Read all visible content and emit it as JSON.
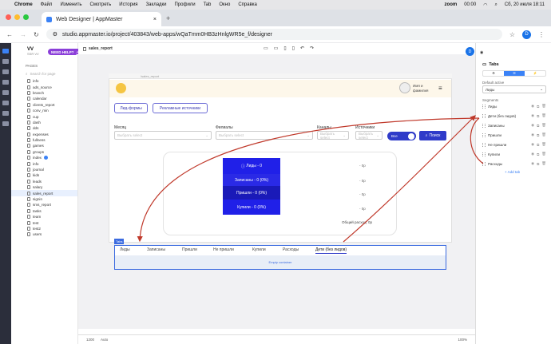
{
  "mac": {
    "app": "Chrome",
    "menu": [
      "Файл",
      "Изменить",
      "Смотреть",
      "История",
      "Закладки",
      "Профили",
      "Tab",
      "Окно",
      "Справка"
    ],
    "status": [
      "zoom",
      "00:00",
      "Сб, 20 июля  18:11"
    ]
  },
  "browser": {
    "tab_title": "Web Designer | AppMaster",
    "url": "studio.appmaster.io/project/403843/web-apps/wQaTmm0HB3zHnlgWR5e_f/designer",
    "profile": "D"
  },
  "project": {
    "name": "VV",
    "sub": "SSR VV",
    "need_help": "NEED HELP?",
    "community": "Ask community!"
  },
  "pages": {
    "header": "PAGES",
    "search": "Search for page",
    "items": [
      "info",
      "ads_source",
      "branch",
      "calendar",
      "clients_report",
      "conv_min",
      "cup",
      "dash",
      "dds",
      "expenses",
      "fullness",
      "games",
      "groups",
      "index",
      "info",
      "journal",
      "kids",
      "leads",
      "salary",
      "sales_report",
      "signin",
      "sms_report",
      "tasks",
      "team",
      "test",
      "test2",
      "users"
    ],
    "selected": "sales_report"
  },
  "toolbar": {
    "tab": "sales_report"
  },
  "preview": {
    "url": "/sales_report",
    "user": "Имя и\nфамилия",
    "btn1": "Лид-формы",
    "btn2": "Рекламные источники",
    "filters": [
      {
        "label": "Месяц",
        "ph": "Выбрать select"
      },
      {
        "label": "Филиалы",
        "ph": "Выбрать select"
      },
      {
        "label": "Каналы",
        "ph": "Выбрать select"
      },
      {
        "label": "Источники",
        "ph": "Выбрать select"
      }
    ],
    "toggle": "Все",
    "search": "Поиск",
    "stats": [
      {
        "t": "Лиды -   0",
        "r": "- 0р"
      },
      {
        "t": "Записаны -   0 (0%)",
        "r": "- 0р"
      },
      {
        "t": "Пришли -   0 (0%)",
        "r": "- 0р"
      },
      {
        "t": "Купили -   0 (0%)",
        "r": "- 0р"
      }
    ],
    "total": "Общий расход: 0р"
  },
  "tabs_component": {
    "badge": "Tabs",
    "items": [
      "Лиды",
      "Записаны",
      "Пришли",
      "Не пришли",
      "Купили",
      "Расходы",
      "Дети (без лидов)"
    ],
    "active": "Дети (без лидов)",
    "empty": "Empty container"
  },
  "rpanel": {
    "title": "Tabs",
    "default_active_label": "Default active",
    "default_active_value": "Лиды",
    "segments_label": "Segments",
    "segments": [
      "Лиды",
      "Дети (без лидов)",
      "Записаны",
      "Пришли",
      "Не пришли",
      "Купили",
      "Расходы"
    ],
    "add": "+ Add tab"
  },
  "bottom": {
    "width": "1200",
    "zoom": "100%",
    "auto": "Auto"
  },
  "colors": {
    "accent": "#3b82f6",
    "stats_blue": "#2020e8",
    "stats_dark": "#1a1ab8",
    "arrow": "#c0392b"
  }
}
